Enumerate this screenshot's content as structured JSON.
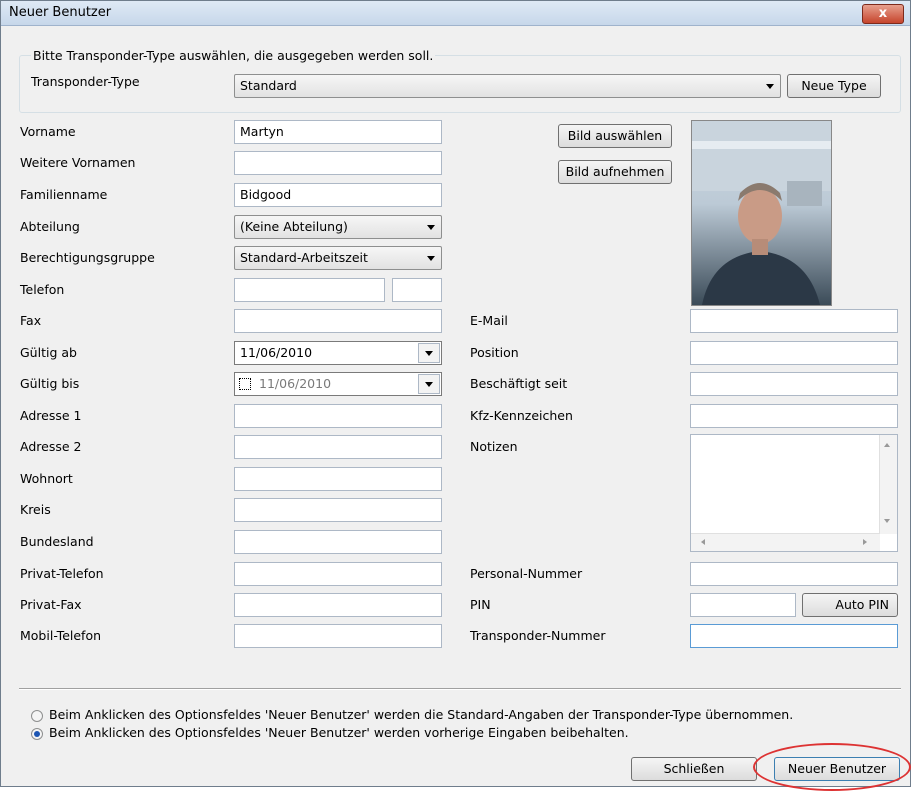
{
  "window": {
    "title": "Neuer Benutzer",
    "close_symbol": "x"
  },
  "transponder": {
    "group_caption": "Bitte Transponder-Type auswählen, die ausgegeben werden soll.",
    "label": "Transponder-Type",
    "value": "Standard",
    "new_type_button": "Neue Type"
  },
  "left_fields": [
    {
      "label": "Vorname",
      "value": "Martyn"
    },
    {
      "label": "Weitere Vornamen",
      "value": ""
    },
    {
      "label": "Familienname",
      "value": "Bidgood"
    },
    {
      "label": "Abteilung",
      "value": "(Keine Abteilung)"
    },
    {
      "label": "Berechtigungsgruppe",
      "value": "Standard-Arbeitszeit"
    },
    {
      "label": "Telefon",
      "value": ""
    },
    {
      "label": "Fax",
      "value": ""
    },
    {
      "label": "Gültig ab",
      "value": "11/06/2010"
    },
    {
      "label": "Gültig bis",
      "value": "11/06/2010"
    },
    {
      "label": "Adresse 1",
      "value": ""
    },
    {
      "label": "Adresse 2",
      "value": ""
    },
    {
      "label": "Wohnort",
      "value": ""
    },
    {
      "label": "Kreis",
      "value": ""
    },
    {
      "label": "Bundesland",
      "value": ""
    },
    {
      "label": "Privat-Telefon",
      "value": ""
    },
    {
      "label": "Privat-Fax",
      "value": ""
    },
    {
      "label": "Mobil-Telefon",
      "value": ""
    }
  ],
  "right_fields": [
    {
      "label": "E-Mail",
      "value": ""
    },
    {
      "label": "Position",
      "value": ""
    },
    {
      "label": "Beschäftigt seit",
      "value": ""
    },
    {
      "label": "Kfz-Kennzeichen",
      "value": ""
    },
    {
      "label": "Notizen",
      "value": ""
    },
    {
      "label": "Personal-Nummer",
      "value": ""
    },
    {
      "label": "PIN",
      "value": ""
    },
    {
      "label": "Transponder-Nummer",
      "value": ""
    }
  ],
  "photo_buttons": {
    "select": "Bild auswählen",
    "capture": "Bild aufnehmen"
  },
  "auto_pin_button": "Auto PIN",
  "options": [
    {
      "text": "Beim Anklicken des Optionsfeldes 'Neuer Benutzer' werden die Standard-Angaben der Transponder-Type übernommen.",
      "selected": false
    },
    {
      "text": "Beim Anklicken des Optionsfeldes 'Neuer Benutzer' werden vorherige Eingaben beibehalten.",
      "selected": true
    }
  ],
  "footer": {
    "close_button": "Schließen",
    "new_user_button": "Neuer Benutzer"
  },
  "colors": {
    "highlight_oval": "#dd3333",
    "radio_dot": "#1d55b3"
  }
}
